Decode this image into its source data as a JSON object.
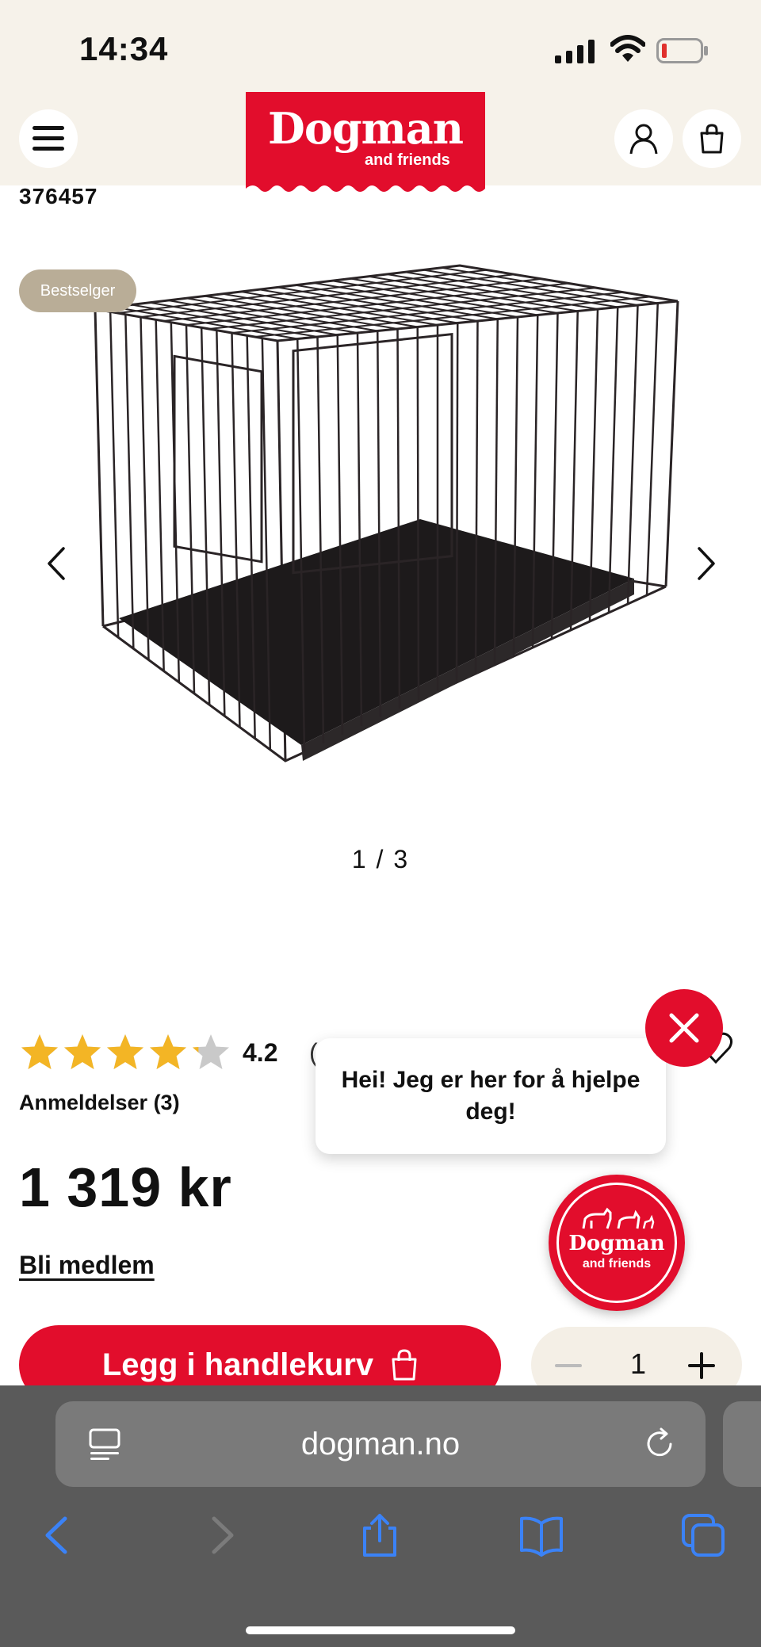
{
  "status_bar": {
    "time": "14:34"
  },
  "header": {
    "logo_text": "Dogman",
    "logo_sub": "and friends",
    "icons": [
      "menu-icon",
      "user-icon",
      "bag-icon"
    ]
  },
  "product": {
    "sku": "376457",
    "badge": "Bestselger",
    "image_counter": "1 / 3",
    "rating_value": 4.2,
    "rating_label": "4.2",
    "rating_paren": "(",
    "reviews_label": "Anmeldelser (3)",
    "price": "1 319 kr",
    "member_link": "Bli medlem",
    "add_to_cart": "Legg i handlekurv",
    "quantity": "1"
  },
  "chat": {
    "message": "Hei! Jeg er her for å hjelpe deg!",
    "avatar_text": "Dogman",
    "avatar_sub": "and friends"
  },
  "browser": {
    "url": "dogman.no"
  },
  "colors": {
    "brand_red": "#e20d2c",
    "header_bg": "#f6f2ea",
    "badge_bg": "#b9ad97",
    "star": "#f3b525",
    "browser_bg": "#5a5a5a",
    "safari_blue": "#3b82f6"
  }
}
